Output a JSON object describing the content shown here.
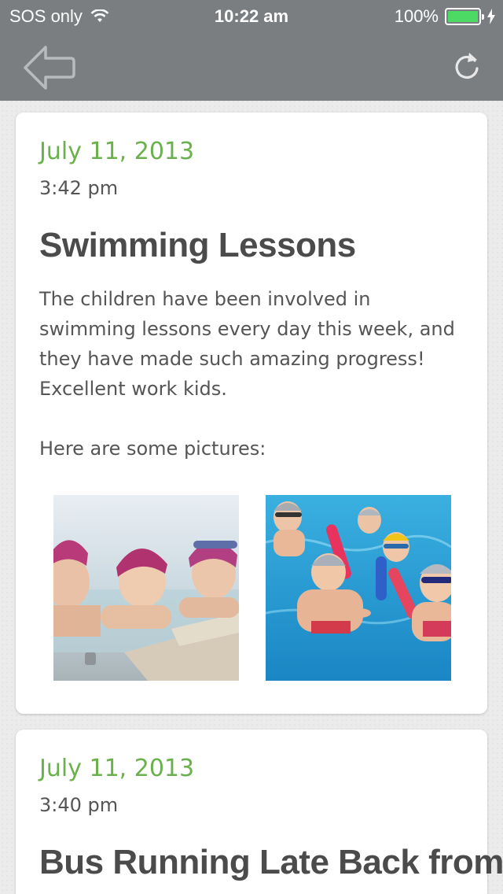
{
  "status_bar": {
    "carrier": "SOS only",
    "time": "10:22 am",
    "battery": "100%"
  },
  "nav": {
    "back_icon": "back-arrow-icon",
    "refresh_icon": "refresh-icon"
  },
  "colors": {
    "bar": "#7a7e80",
    "date": "#6ab04c",
    "title": "#4b4b4b"
  },
  "posts": [
    {
      "date": "July 11, 2013",
      "time": "3:42 pm",
      "title": "Swimming Lessons",
      "body": "The children have been involved in swimming lessons every day this week, and they have made such amazing progress! Excellent work kids.",
      "pictures_intro": "Here are some pictures:"
    },
    {
      "date": "July 11, 2013",
      "time": "3:40 pm",
      "title": "Bus Running Late Back from"
    }
  ]
}
